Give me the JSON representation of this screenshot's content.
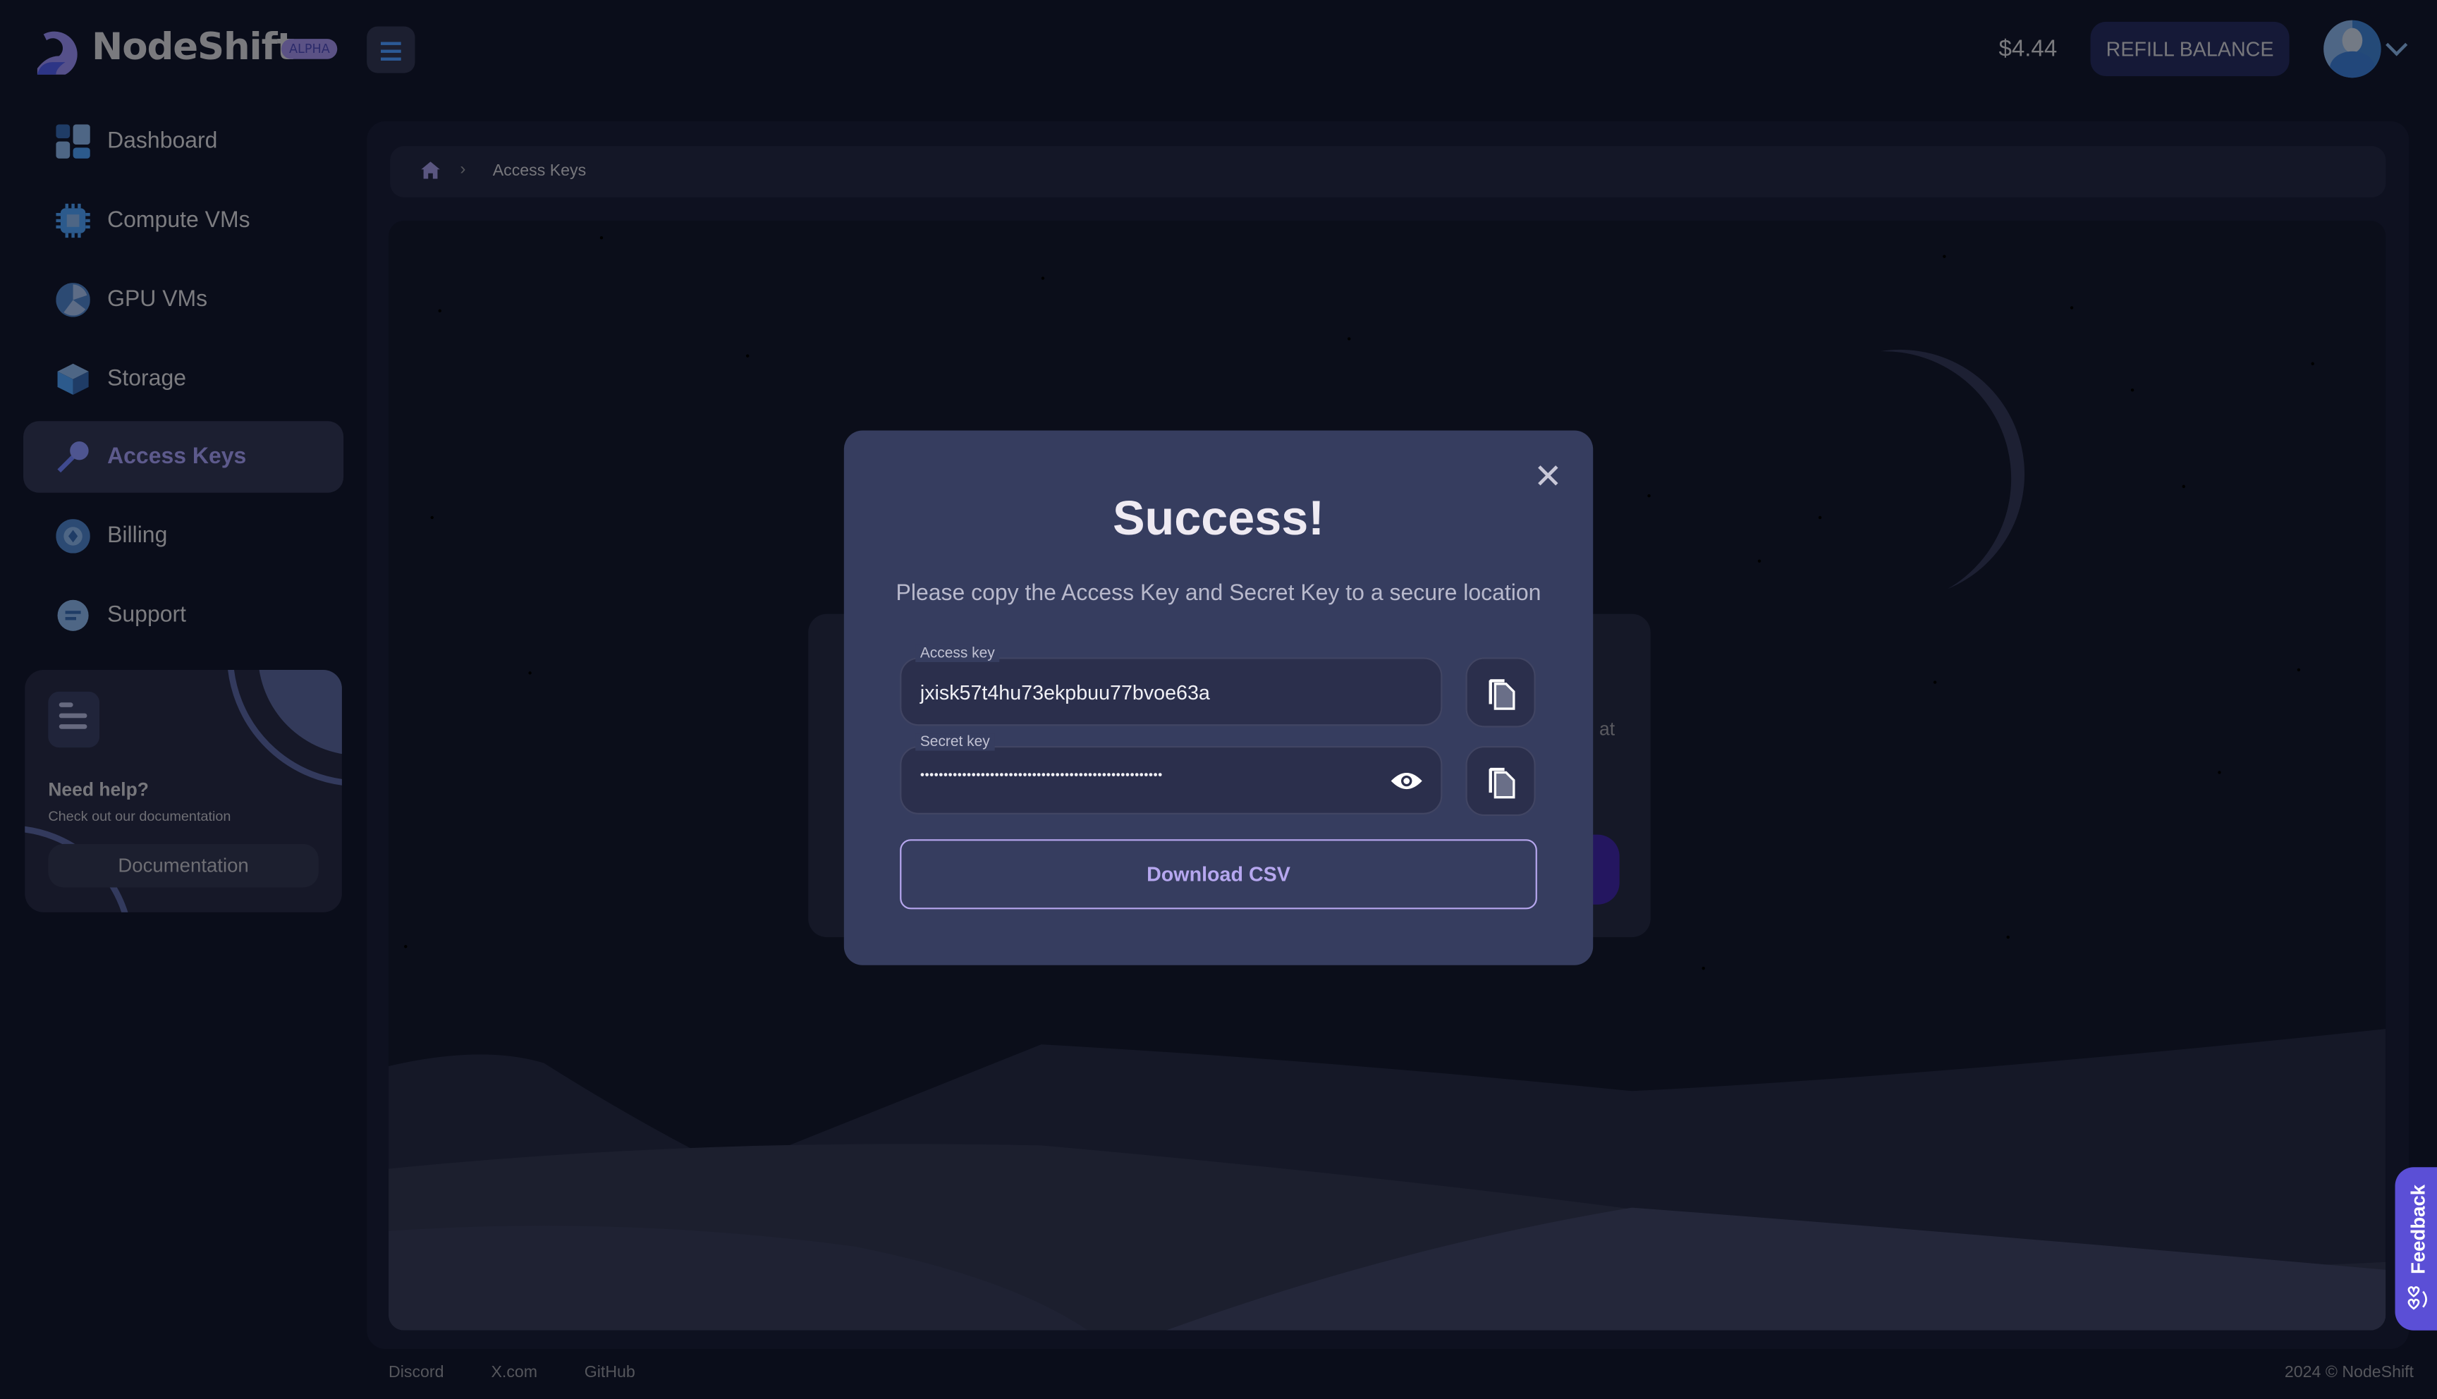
{
  "header": {
    "brand": "NodeShift",
    "badge": "ALPHA",
    "balance": "$4.44",
    "refill_label": "REFILL BALANCE"
  },
  "sidebar": {
    "items": [
      {
        "label": "Dashboard",
        "icon": "dashboard-icon"
      },
      {
        "label": "Compute VMs",
        "icon": "cpu-icon"
      },
      {
        "label": "GPU VMs",
        "icon": "gpu-icon"
      },
      {
        "label": "Storage",
        "icon": "cube-icon"
      },
      {
        "label": "Access Keys",
        "icon": "key-icon",
        "active": true
      },
      {
        "label": "Billing",
        "icon": "billing-icon"
      },
      {
        "label": "Support",
        "icon": "chat-icon"
      }
    ],
    "help": {
      "title": "Need help?",
      "subtitle": "Check out our documentation",
      "button": "Documentation"
    }
  },
  "breadcrumb": {
    "current": "Access Keys"
  },
  "background_card": {
    "partial_text": "at"
  },
  "modal": {
    "title": "Success!",
    "subtitle": "Please copy the Access Key and Secret Key to a secure location",
    "access_key_label": "Access key",
    "access_key_value": "jxisk57t4hu73ekpbuu77bvoe63a",
    "secret_key_label": "Secret key",
    "secret_key_value": "••••••••••••••••••••••••••••••••••••••••••••••••••••",
    "download_label": "Download CSV"
  },
  "footer": {
    "links": [
      "Discord",
      "X.com",
      "GitHub"
    ],
    "copyright": "2024 © NodeShift"
  },
  "feedback_label": "Feedback",
  "colors": {
    "accent": "#5b4fd6",
    "modal_bg": "#363d5f",
    "download_border": "#b7a7ef"
  }
}
